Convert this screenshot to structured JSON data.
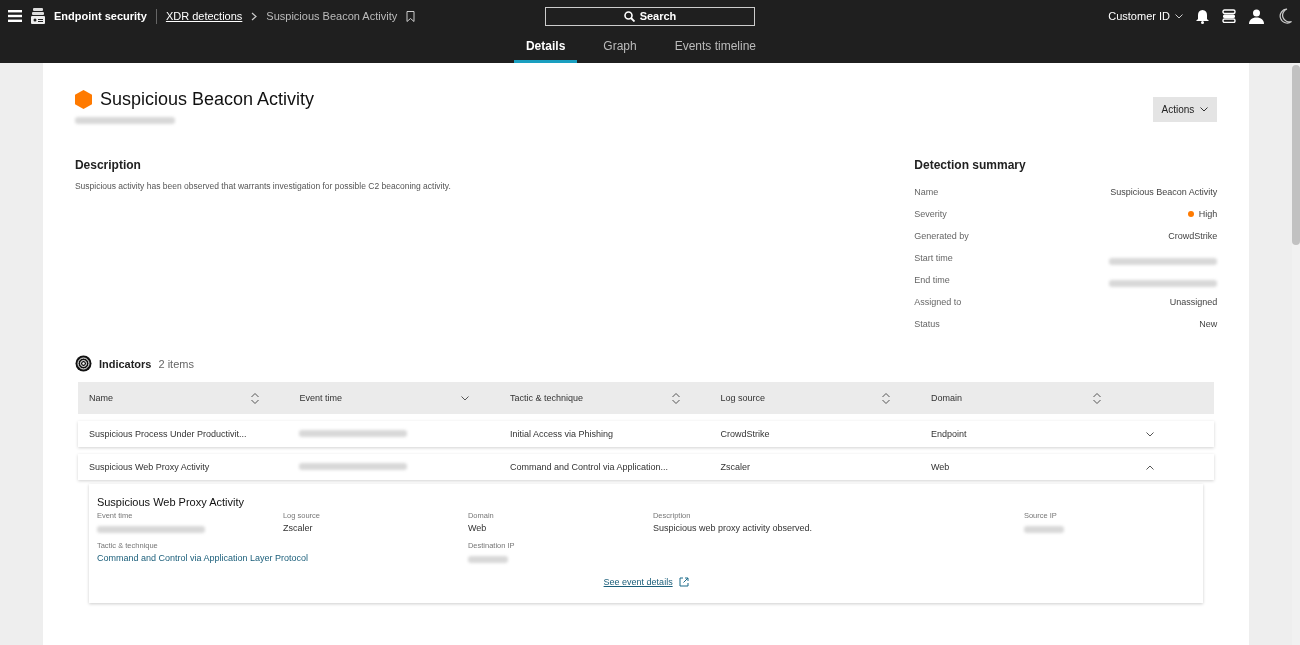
{
  "top_bar": {
    "product": "Endpoint security",
    "breadcrumb": [
      {
        "label": "XDR detections",
        "link": true
      },
      {
        "label": "Suspicious Beacon Activity",
        "link": false
      }
    ],
    "search": {
      "label": "Search"
    },
    "customer": "Customer ID"
  },
  "tabs": [
    {
      "label": "Details",
      "selected": true
    },
    {
      "label": "Graph",
      "selected": false
    },
    {
      "label": "Events timeline",
      "selected": false
    }
  ],
  "detection": {
    "title": "Suspicious Beacon Activity",
    "actions": "Actions"
  },
  "description": {
    "heading": "Description",
    "text": "Suspicious activity has been observed that warrants investigation for possible C2 beaconing activity."
  },
  "summary": {
    "heading": "Detection summary",
    "items": [
      {
        "label": "Name",
        "value": "Suspicious Beacon Activity",
        "kind": "text"
      },
      {
        "label": "Severity",
        "value": "High",
        "kind": "severity",
        "color": "#ff7a00"
      },
      {
        "label": "Generated by",
        "value": "CrowdStrike",
        "kind": "text"
      },
      {
        "label": "Start time",
        "kind": "redacted"
      },
      {
        "label": "End time",
        "kind": "redacted"
      },
      {
        "label": "Assigned to",
        "value": "Unassigned",
        "kind": "text"
      },
      {
        "label": "Status",
        "value": "New",
        "kind": "text"
      }
    ]
  },
  "indicators": {
    "heading": "Indicators",
    "count": "2 items",
    "columns": [
      {
        "label": "Name",
        "sorted": false
      },
      {
        "label": "Event time",
        "sorted": true
      },
      {
        "label": "Tactic & technique",
        "sorted": false
      },
      {
        "label": "Log source",
        "sorted": false
      },
      {
        "label": "Domain",
        "sorted": false
      }
    ],
    "rows": [
      {
        "name": "Suspicious Process Under Productivit...",
        "tactic": "Initial Access via Phishing",
        "log_source": "CrowdStrike",
        "domain": "Endpoint",
        "expanded": false
      },
      {
        "name": "Suspicious Web Proxy Activity",
        "tactic": "Command and Control via Application...",
        "log_source": "Zscaler",
        "domain": "Web",
        "expanded": true
      }
    ],
    "detail": {
      "title": "Suspicious Web Proxy Activity",
      "fields": [
        {
          "label": "Event time",
          "kind": "redacted"
        },
        {
          "label": "Log source",
          "value": "Zscaler",
          "kind": "text"
        },
        {
          "label": "Domain",
          "value": "Web",
          "kind": "text"
        },
        {
          "label": "Description",
          "value": "Suspicious web proxy activity observed.",
          "kind": "text"
        },
        {
          "label": "Source IP",
          "kind": "redacted"
        },
        {
          "label": "Tactic & technique",
          "value": "Command and Control via Application Layer Protocol",
          "kind": "link"
        },
        {
          "label": "Destination IP",
          "kind": "redacted"
        }
      ],
      "link": "See event details"
    }
  }
}
